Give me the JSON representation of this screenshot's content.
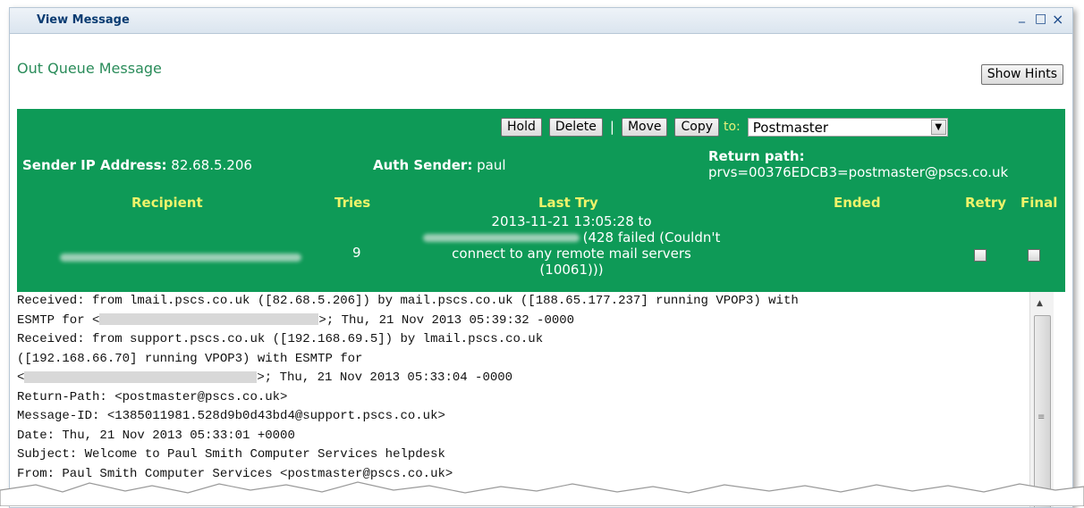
{
  "window": {
    "title": "View Message",
    "minimize_icon": "minimize-icon",
    "maximize_icon": "maximize-icon",
    "close_icon": "close-icon",
    "minimize_glyph": "_",
    "maximize_glyph": "□",
    "close_glyph": "×"
  },
  "page_title": "Out Queue Message",
  "show_hints_label": "Show Hints",
  "toolbar": {
    "hold_label": "Hold",
    "delete_label": "Delete",
    "separator": "|",
    "move_label": "Move",
    "copy_label": "Copy",
    "to_label": "to:",
    "folder_selected": "Postmaster"
  },
  "sender": {
    "ip_label": "Sender IP Address:",
    "ip_value": "82.68.5.206",
    "auth_label": "Auth Sender:",
    "auth_value": "paul",
    "return_path_label": "Return path:",
    "return_path_value": "prvs=00376EDCB3=postmaster@pscs.co.uk"
  },
  "recipients_table": {
    "headers": [
      "Recipient",
      "Tries",
      "Last Try",
      "Ended",
      "Retry",
      "Final"
    ],
    "rows": [
      {
        "recipient": "",
        "tries": "9",
        "last_try_line1": "2013-11-21 13:05:28 to",
        "last_try_line2": "(428 failed (Couldn't",
        "last_try_line3": "connect to any remote mail servers",
        "last_try_line4": "(10061)))",
        "ended": "",
        "retry_checked": false,
        "final_checked": false
      }
    ]
  },
  "message_headers": [
    "Received: from lmail.pscs.co.uk ([82.68.5.206]) by mail.pscs.co.uk ([188.65.177.237] running VPOP3) with",
    "ESMTP for <",
    ">; Thu, 21 Nov 2013 05:39:32 -0000",
    "Received: from support.pscs.co.uk ([192.168.69.5]) by lmail.pscs.co.uk",
    "([192.168.66.70] running VPOP3) with ESMTP for",
    "<",
    ">; Thu, 21 Nov 2013 05:33:04 -0000",
    "Return-Path: <postmaster@pscs.co.uk>",
    "Message-ID: <1385011981.528d9b0d43bd4@support.pscs.co.uk>",
    "Date: Thu, 21 Nov 2013 05:33:01 +0000",
    "Subject: Welcome to Paul Smith Computer Services helpdesk",
    "From: Paul Smith Computer Services <postmaster@pscs.co.uk>"
  ],
  "colors": {
    "panel_green": "#0e9a57",
    "header_yellow": "#eef36a",
    "title_green": "#2a8c5a",
    "title_blue": "#0a3c72"
  }
}
